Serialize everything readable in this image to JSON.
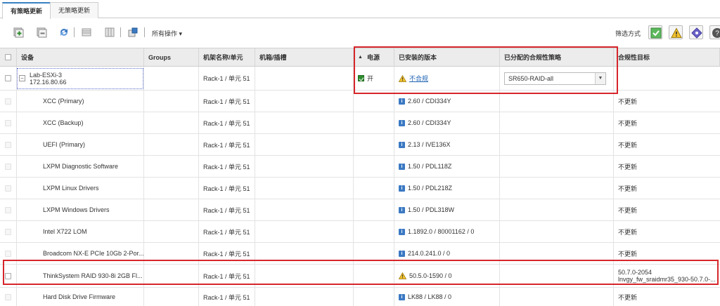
{
  "tabs": [
    {
      "label": "有策略更新",
      "active": true
    },
    {
      "label": "无策略更新",
      "active": false
    }
  ],
  "toolbar": {
    "all_actions_label": "所有操作 ▾",
    "filter_label": "筛选方式",
    "icons": [
      "add-icon",
      "remove-icon",
      "refresh-icon",
      "grid-icon",
      "columns-icon",
      "export-icon"
    ],
    "filter_icons": [
      "check-filter-icon",
      "warning-filter-icon",
      "diamond-filter-icon",
      "help-filter-icon"
    ]
  },
  "table": {
    "columns": {
      "device": "设备",
      "groups": "Groups",
      "rack": "机架名称/单元",
      "slot": "机箱/插槽",
      "power": "电源",
      "installed": "已安装的版本",
      "policy": "已分配的合规性策略",
      "target": "合规性目标"
    },
    "parent": {
      "name": "Lab-ESXi-3",
      "ip": "172.16.80.66",
      "rack": "Rack-1 / 单元 51",
      "power": "开",
      "installed": "不合规",
      "policy": "SR650-RAID-all"
    },
    "rows": [
      {
        "device": "XCC (Primary)",
        "rack": "Rack-1 / 单元 51",
        "installed": "2.60 / CDI334Y",
        "target": "不更新"
      },
      {
        "device": "XCC (Backup)",
        "rack": "Rack-1 / 单元 51",
        "installed": "2.60 / CDI334Y",
        "target": "不更新"
      },
      {
        "device": "UEFI (Primary)",
        "rack": "Rack-1 / 单元 51",
        "installed": "2.13 / IVE136X",
        "target": "不更新"
      },
      {
        "device": "LXPM Diagnostic Software",
        "rack": "Rack-1 / 单元 51",
        "installed": "1.50 / PDL118Z",
        "target": "不更新"
      },
      {
        "device": "LXPM Linux Drivers",
        "rack": "Rack-1 / 单元 51",
        "installed": "1.50 / PDL218Z",
        "target": "不更新"
      },
      {
        "device": "LXPM Windows Drivers",
        "rack": "Rack-1 / 单元 51",
        "installed": "1.50 / PDL318W",
        "target": "不更新"
      },
      {
        "device": "Intel X722 LOM",
        "rack": "Rack-1 / 单元 51",
        "installed": "1.1892.0 / 80001162 / 0",
        "target": "不更新"
      },
      {
        "device": "Broadcom NX-E PCIe 10Gb 2-Por...",
        "rack": "Rack-1 / 单元 51",
        "installed": "214.0.241.0 / 0",
        "target": "不更新"
      },
      {
        "device": "ThinkSystem RAID 930-8i 2GB Fl...",
        "rack": "Rack-1 / 单元 51",
        "installed": "50.5.0-1590 / 0",
        "target1": "50.7.0-2054",
        "target2": "lnvgy_fw_sraidmr35_930-50.7.0-..."
      },
      {
        "device": "Hard Disk Drive Firmware",
        "rack": "Rack-1 / 单元 51",
        "installed": "LK88 / LK88 / 0",
        "target": "不更新"
      }
    ]
  },
  "colors": {
    "highlight": "#d6262b",
    "info": "#3b79c3",
    "link": "#1f63b4",
    "power_on": "#2e8b2e"
  }
}
